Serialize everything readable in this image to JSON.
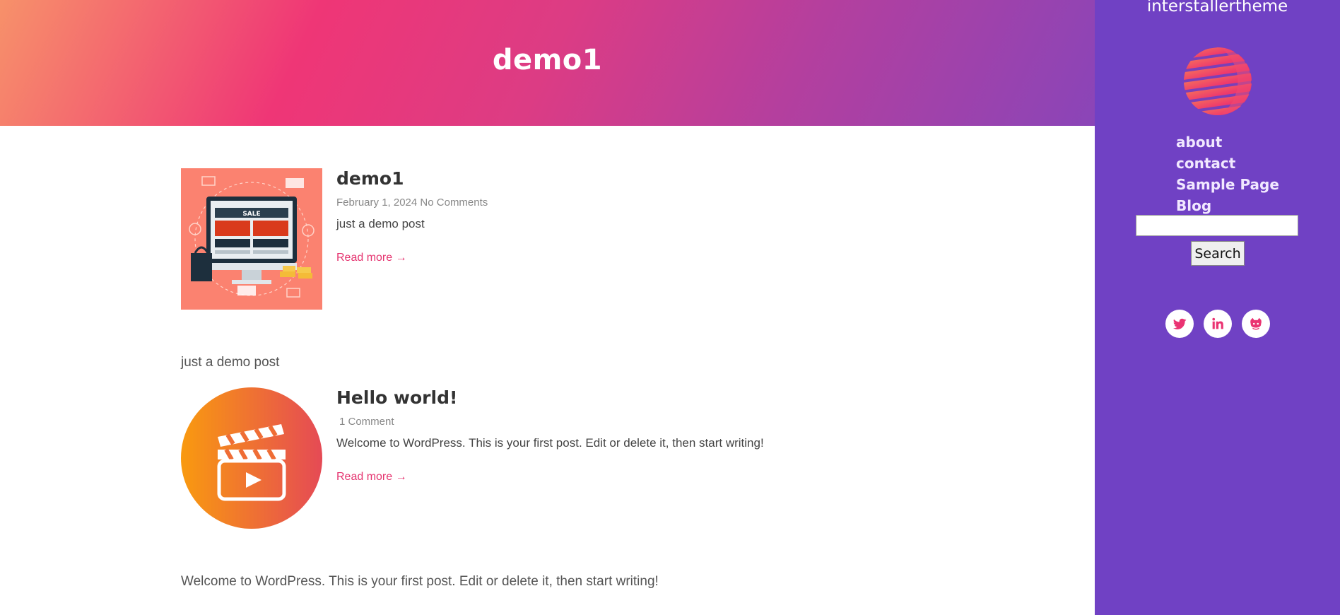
{
  "header": {
    "title": "demo1"
  },
  "sidebar": {
    "site_title": "interstallertheme",
    "nav": [
      {
        "label": "about"
      },
      {
        "label": "contact"
      },
      {
        "label": "Sample Page"
      },
      {
        "label": "Blog"
      }
    ],
    "search": {
      "value": "",
      "placeholder": "",
      "button_label": "Search"
    },
    "social": [
      "twitter-icon",
      "linkedin-icon",
      "github-icon"
    ]
  },
  "posts": [
    {
      "title": "demo1",
      "date": "February 1, 2024",
      "comments": "No Comments",
      "excerpt": "just a demo post",
      "read_more": "Read more →",
      "full_text": "just a demo post"
    },
    {
      "title": "Hello world!",
      "date": "",
      "comments": "1 Comment",
      "excerpt": "Welcome to WordPress. This is your first post. Edit or delete it, then start writing!",
      "read_more": "Read more →",
      "full_text": "Welcome to WordPress. This is your first post. Edit or delete it, then start writing!"
    }
  ],
  "colors": {
    "accent": "#e5336f",
    "sidebar": "#7041c4"
  }
}
